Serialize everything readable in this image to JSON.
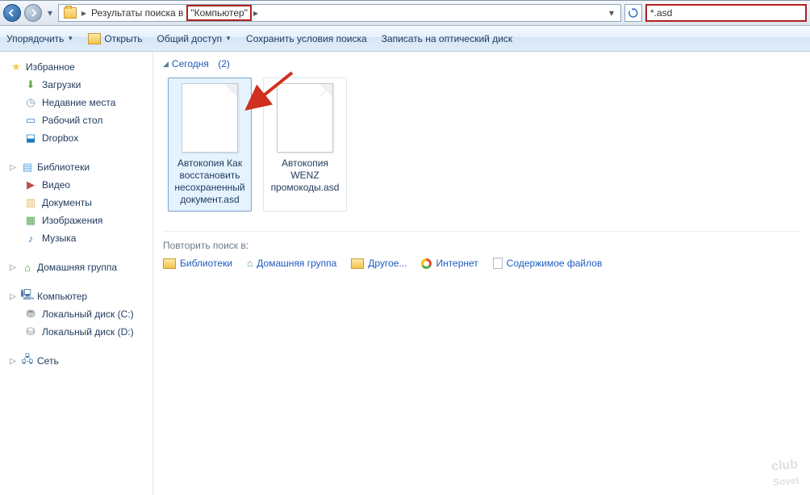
{
  "addressbar": {
    "prefix": "Результаты поиска в",
    "location": "\"Компьютер\""
  },
  "search": {
    "query": "*.asd"
  },
  "toolbar": {
    "organize": "Упорядочить",
    "open": "Открыть",
    "share": "Общий доступ",
    "save_search": "Сохранить условия поиска",
    "burn": "Записать на оптический диск"
  },
  "sidebar": {
    "favorites": {
      "title": "Избранное",
      "items": [
        "Загрузки",
        "Недавние места",
        "Рабочий стол",
        "Dropbox"
      ]
    },
    "libraries": {
      "title": "Библиотеки",
      "items": [
        "Видео",
        "Документы",
        "Изображения",
        "Музыка"
      ]
    },
    "homegroup": {
      "title": "Домашняя группа"
    },
    "computer": {
      "title": "Компьютер",
      "items": [
        "Локальный диск (C:)",
        "Локальный диск (D:)"
      ]
    },
    "network": {
      "title": "Сеть"
    }
  },
  "content": {
    "section_label": "Сегодня",
    "section_count": "(2)",
    "files": [
      {
        "name": "Автокопия Как восстановить несохраненный документ.asd"
      },
      {
        "name": "Автокопия WENZ промокоды.asd"
      }
    ],
    "repeat": {
      "label": "Повторить поиск в:",
      "locations": [
        "Библиотеки",
        "Домашняя группа",
        "Другое...",
        "Интернет",
        "Содержимое файлов"
      ]
    }
  },
  "watermark": {
    "line1": "club",
    "line2": "Sovet"
  }
}
